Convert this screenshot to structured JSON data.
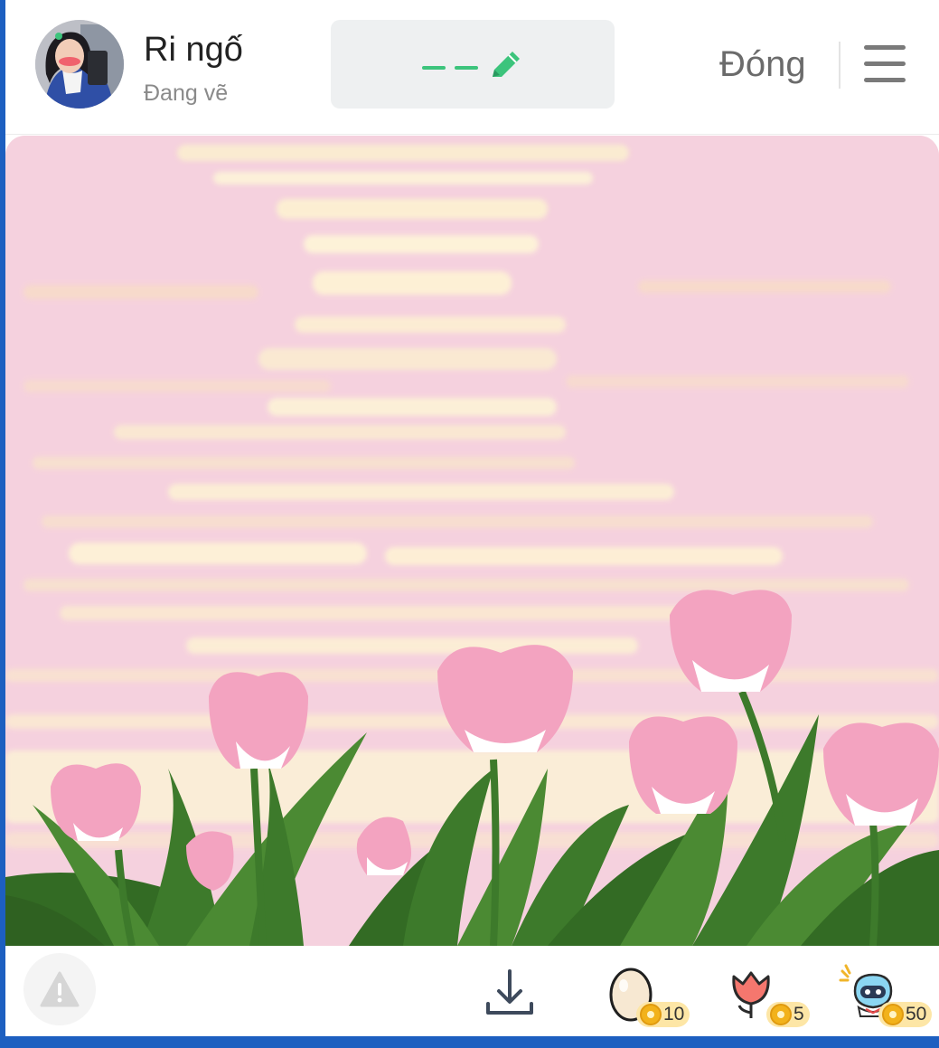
{
  "header": {
    "user_name": "Ri ngố",
    "user_status": "Đang vẽ",
    "close_label": "Đóng",
    "pen_icon": "pencil-icon",
    "menu_icon": "hamburger-icon"
  },
  "canvas": {
    "description_icon": "drawing-canvas"
  },
  "footer": {
    "report_icon": "warning-icon",
    "download_icon": "download-icon",
    "gifts": [
      {
        "icon": "egg-icon",
        "price": "10"
      },
      {
        "icon": "tulip-icon",
        "price": "5"
      },
      {
        "icon": "robot-mascot-icon",
        "price": "50"
      }
    ]
  },
  "colors": {
    "accent_green": "#3cc47c",
    "canvas_pink": "#f5d1de",
    "bottom_bar_blue": "#1d5fc0"
  }
}
